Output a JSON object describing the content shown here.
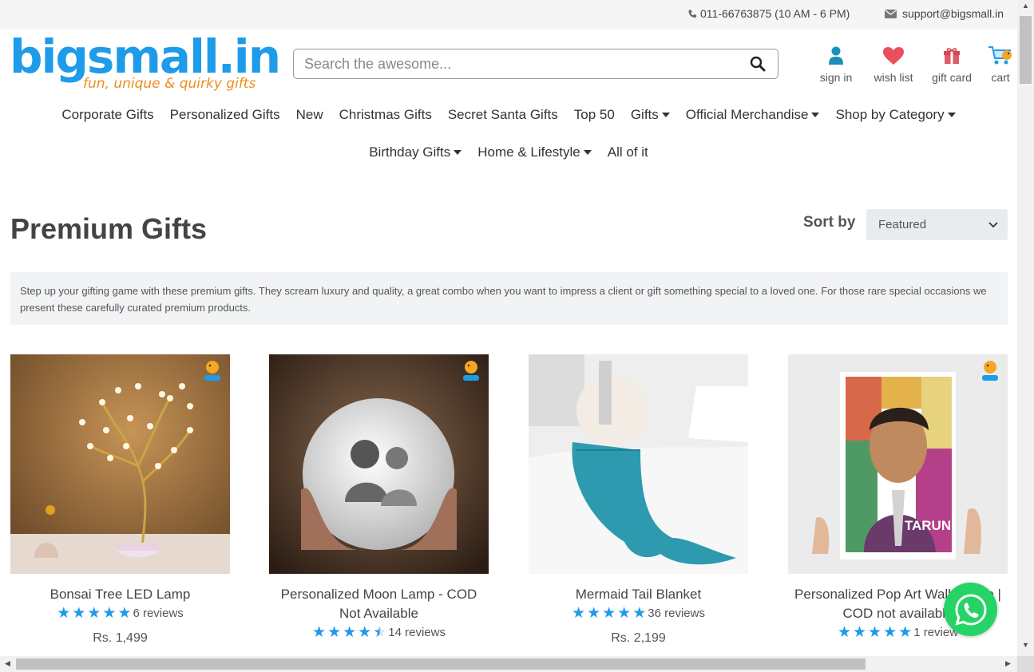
{
  "topbar": {
    "phone": "011-66763875 (10 AM - 6 PM)",
    "email": "support@bigsmall.in"
  },
  "logo": {
    "name": "bigsmall.in",
    "tagline": "fun, unique & quirky gifts"
  },
  "search": {
    "placeholder": "Search the awesome..."
  },
  "header_icons": [
    {
      "label": "sign in",
      "icon": "user-icon"
    },
    {
      "label": "wish list",
      "icon": "heart-icon"
    },
    {
      "label": "gift card",
      "icon": "gift-icon"
    },
    {
      "label": "cart",
      "icon": "cart-icon"
    }
  ],
  "nav": {
    "row1": [
      {
        "label": "Corporate Gifts",
        "dropdown": false
      },
      {
        "label": "Personalized Gifts",
        "dropdown": false
      },
      {
        "label": "New",
        "dropdown": false
      },
      {
        "label": "Christmas Gifts",
        "dropdown": false
      },
      {
        "label": "Secret Santa Gifts",
        "dropdown": false
      },
      {
        "label": "Top 50",
        "dropdown": false
      },
      {
        "label": "Gifts",
        "dropdown": true
      },
      {
        "label": "Official Merchandise",
        "dropdown": true
      },
      {
        "label": "Shop by Category",
        "dropdown": true
      }
    ],
    "row2": [
      {
        "label": "Birthday Gifts",
        "dropdown": true
      },
      {
        "label": "Home & Lifestyle",
        "dropdown": true
      },
      {
        "label": "All of it",
        "dropdown": false
      }
    ]
  },
  "page": {
    "title": "Premium Gifts",
    "sort_label": "Sort by",
    "sort_value": "Featured",
    "description": "Step up your gifting game with these premium gifts. They scream luxury and quality, a great combo when you want to impress a client or gift something special to a loved one. For those rare special occasions we present these carefully curated premium products."
  },
  "products": [
    {
      "name": "Bonsai Tree LED Lamp",
      "rating": 5,
      "reviews": "6 reviews",
      "price": "Rs. 1,499"
    },
    {
      "name": "Personalized Moon Lamp - COD Not Available",
      "rating": 4.5,
      "reviews": "14 reviews",
      "price": ""
    },
    {
      "name": "Mermaid Tail Blanket",
      "rating": 5,
      "reviews": "36 reviews",
      "price": "Rs. 2,199"
    },
    {
      "name": "Personalized Pop Art Wall Frame | COD not available",
      "rating": 5,
      "reviews": "1 review",
      "price": ""
    }
  ],
  "poster_text": "TARUN",
  "colors": {
    "brand_blue": "#1e9be9",
    "brand_orange": "#f08c1e",
    "whatsapp_green": "#25d366",
    "heart_red": "#e8505b",
    "user_teal": "#1a8fb8"
  }
}
